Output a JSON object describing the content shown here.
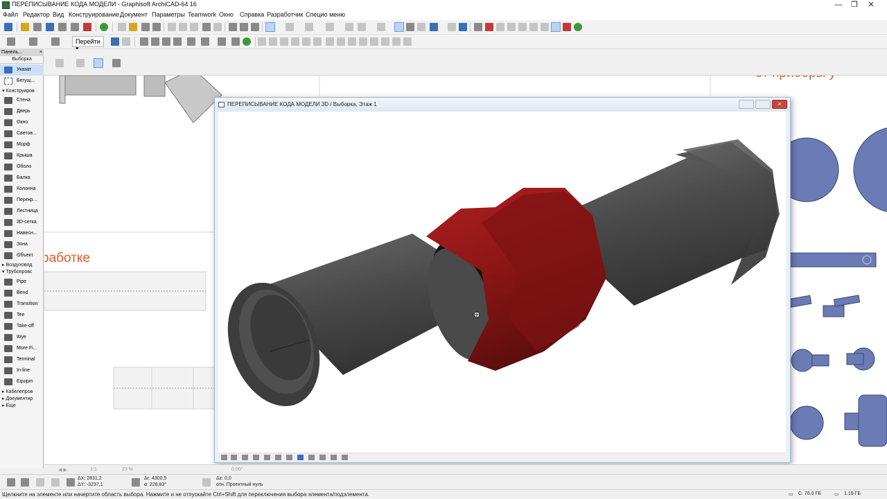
{
  "app": {
    "title": "ПЕРЕПИСЫВАНИЕ КОДА МОДЕЛИ - Graphisoft ArchiCAD-64 16"
  },
  "menubar": {
    "items": [
      "Файл",
      "Редактор",
      "Вид",
      "Конструирование",
      "Документ",
      "Параметры",
      "Teamwork",
      "Окно",
      "Справка",
      "Разработчик",
      "Специо меню"
    ]
  },
  "toolbar": {
    "goto_label": "Перейти"
  },
  "toolbox": {
    "header": "Панель...",
    "close": "×",
    "section_selection": "Выборка",
    "tools": [
      {
        "label": "Указат",
        "icon": "arrow-pointer-icon",
        "active": true
      },
      {
        "label": "Бегущ...",
        "icon": "marquee-icon"
      }
    ],
    "group_design": "Конструиров",
    "design_tools": [
      {
        "label": "Стена",
        "icon": "wall-icon"
      },
      {
        "label": "Дверь",
        "icon": "door-icon"
      },
      {
        "label": "Окно",
        "icon": "window-icon"
      },
      {
        "label": "Светов...",
        "icon": "skylight-icon"
      },
      {
        "label": "Морф",
        "icon": "morph-icon"
      },
      {
        "label": "Крыша",
        "icon": "roof-icon"
      },
      {
        "label": "Оболо",
        "icon": "shell-icon"
      },
      {
        "label": "Балка",
        "icon": "beam-icon"
      },
      {
        "label": "Колонна",
        "icon": "column-icon"
      },
      {
        "label": "Перекр...",
        "icon": "slab-icon"
      },
      {
        "label": "Лестница",
        "icon": "stair-icon"
      },
      {
        "label": "3D-сетка",
        "icon": "mesh-icon"
      },
      {
        "label": "Навесн...",
        "icon": "curtain-wall-icon"
      },
      {
        "label": "Зона",
        "icon": "zone-icon"
      },
      {
        "label": "Объект",
        "icon": "object-icon"
      }
    ],
    "group_air": "Воздуховод",
    "group_pipes": "Трубопровс",
    "pipe_tools": [
      {
        "label": "Pipe",
        "icon": "pipe-icon"
      },
      {
        "label": "Bend",
        "icon": "bend-icon"
      },
      {
        "label": "Transition",
        "icon": "transition-icon"
      },
      {
        "label": "Tee",
        "icon": "tee-icon"
      },
      {
        "label": "Take-off",
        "icon": "takeoff-icon"
      },
      {
        "label": "Wye",
        "icon": "wye-icon"
      },
      {
        "label": "More Fi...",
        "icon": "more-fittings-icon"
      },
      {
        "label": "Terminal",
        "icon": "terminal-icon"
      },
      {
        "label": "In-line",
        "icon": "inline-icon"
      },
      {
        "label": "Equipm",
        "icon": "equipment-icon"
      }
    ],
    "group_cable": "Кабелепров",
    "group_doc": "Документир",
    "group_more": "Еще"
  },
  "plan": {
    "orange_text_1": "работке",
    "orange_text_2": "от приборы у"
  },
  "window3d": {
    "title": "ПЕРЕПИСЫВАНИЕ КОДА МОДЕЛИ 3D / Выборка, Этаж 1",
    "close": "×"
  },
  "plan_bottom": {
    "scale": "1:1",
    "zoom": "23 %",
    "angle": "0,00°"
  },
  "coords": {
    "dx": "ΔX: 2831,2",
    "dy": "ΔY: -3237,1",
    "ar": "Δr: 4300,5",
    "ang": "α: 228,83°",
    "dz": "Δz: 0,0",
    "ref": "отн. Проектный нуль"
  },
  "status": {
    "message": "Щелкните на элементе или начертите область выбора. Нажмите и не отпускайте Ctrl+Shift для переключения выбора элемента/подэлемента.",
    "disk1": "С: 76.0 ГБ",
    "disk2": "1.19 ГБ"
  },
  "colors": {
    "pipe": "#4a4a4a",
    "coupling": "#8c1616",
    "orange_text": "#e2582a",
    "plan_fixture": "#6b7bb5"
  }
}
